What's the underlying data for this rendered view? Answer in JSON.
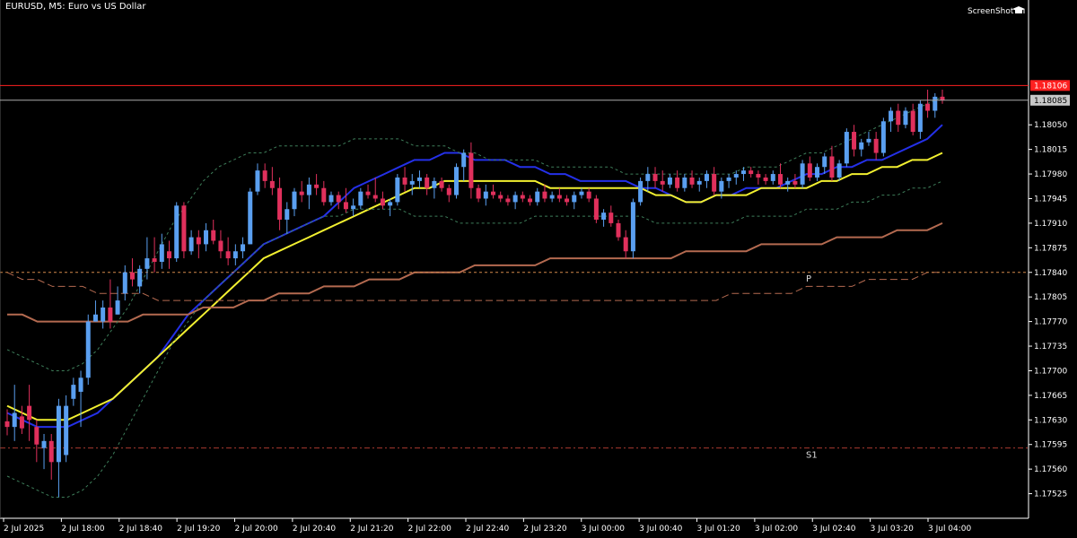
{
  "window": {
    "title": "EURUSD, M5:  Euro vs US Dollar"
  },
  "brand": {
    "label": "ScreenShot",
    "icon": "graduation-cap-icon"
  },
  "colors": {
    "background": "#000000",
    "axis": "#ffffff",
    "bull": "#5a9ff0",
    "bear": "#e0305c",
    "ma_fast": "#2430e8",
    "ma_mid": "#f2f030",
    "ma_slow": "#b46a50",
    "bollinger": "#3e7e5a",
    "pivot": "#d2884a",
    "s1": "#a83a30",
    "ask_line": "#ff2020",
    "bid_line": "#aaaaaa"
  },
  "chart_data": {
    "type": "candlestick",
    "symbol": "EURUSD",
    "timeframe": "M5",
    "description": "Euro vs US Dollar",
    "ylim": [
      1.1749,
      1.1822
    ],
    "price_ticks": [
      "1.18050",
      "1.18015",
      "1.17980",
      "1.17945",
      "1.17910",
      "1.17875",
      "1.17840",
      "1.17805",
      "1.17770",
      "1.17735",
      "1.17700",
      "1.17665",
      "1.17630",
      "1.17595",
      "1.17560",
      "1.17525"
    ],
    "time_ticks": [
      "2 Jul 2025",
      "2 Jul 18:00",
      "2 Jul 18:40",
      "2 Jul 19:20",
      "2 Jul 20:00",
      "2 Jul 20:40",
      "2 Jul 21:20",
      "2 Jul 22:00",
      "2 Jul 22:40",
      "2 Jul 23:20",
      "3 Jul 00:00",
      "3 Jul 00:40",
      "3 Jul 01:20",
      "3 Jul 02:00",
      "3 Jul 02:40",
      "3 Jul 03:20",
      "3 Jul 04:00"
    ],
    "ask_price": "1.18106",
    "bid_price": "1.18085",
    "levels": [
      {
        "name": "P",
        "price": 1.1784
      },
      {
        "name": "S1",
        "price": 1.1759
      }
    ],
    "candles": [
      [
        1.17628,
        1.17645,
        1.17608,
        1.1762
      ],
      [
        1.1762,
        1.1768,
        1.176,
        1.1764
      ],
      [
        1.17635,
        1.1765,
        1.1761,
        1.17618
      ],
      [
        1.1765,
        1.1768,
        1.176,
        1.1763
      ],
      [
        1.1762,
        1.1763,
        1.1757,
        1.17595
      ],
      [
        1.1759,
        1.1761,
        1.1756,
        1.176
      ],
      [
        1.176,
        1.1761,
        1.17545,
        1.1757
      ],
      [
        1.1757,
        1.1766,
        1.1752,
        1.1765
      ],
      [
        1.1758,
        1.17665,
        1.1757,
        1.1765
      ],
      [
        1.1766,
        1.1769,
        1.1765,
        1.1768
      ],
      [
        1.1767,
        1.177,
        1.1762,
        1.1769
      ],
      [
        1.1769,
        1.1778,
        1.1768,
        1.1777
      ],
      [
        1.1777,
        1.178,
        1.1777,
        1.1778
      ],
      [
        1.1777,
        1.178,
        1.1776,
        1.1779
      ],
      [
        1.1779,
        1.1783,
        1.1776,
        1.1777
      ],
      [
        1.1778,
        1.1782,
        1.1778,
        1.178
      ],
      [
        1.1781,
        1.1785,
        1.178,
        1.1784
      ],
      [
        1.1784,
        1.1786,
        1.1782,
        1.1783
      ],
      [
        1.1782,
        1.1785,
        1.1781,
        1.17845
      ],
      [
        1.17845,
        1.1789,
        1.1783,
        1.1786
      ],
      [
        1.1786,
        1.1789,
        1.1784,
        1.17855
      ],
      [
        1.17855,
        1.17895,
        1.17845,
        1.1788
      ],
      [
        1.1787,
        1.17885,
        1.17845,
        1.1786
      ],
      [
        1.1786,
        1.1794,
        1.17855,
        1.17935
      ],
      [
        1.17935,
        1.1794,
        1.1786,
        1.1787
      ],
      [
        1.1787,
        1.179,
        1.17865,
        1.1789
      ],
      [
        1.1789,
        1.179,
        1.1786,
        1.1788
      ],
      [
        1.1788,
        1.1791,
        1.1787,
        1.179
      ],
      [
        1.179,
        1.17915,
        1.1788,
        1.17885
      ],
      [
        1.17885,
        1.179,
        1.1786,
        1.1787
      ],
      [
        1.1787,
        1.1789,
        1.1785,
        1.1786
      ],
      [
        1.1786,
        1.1788,
        1.1785,
        1.1787
      ],
      [
        1.1787,
        1.1789,
        1.1786,
        1.1788
      ],
      [
        1.1788,
        1.1796,
        1.1788,
        1.17955
      ],
      [
        1.17955,
        1.17995,
        1.1795,
        1.17985
      ],
      [
        1.17985,
        1.17995,
        1.1796,
        1.1797
      ],
      [
        1.1797,
        1.1799,
        1.1795,
        1.1796
      ],
      [
        1.1796,
        1.17975,
        1.179,
        1.17915
      ],
      [
        1.17915,
        1.1794,
        1.17895,
        1.1793
      ],
      [
        1.1793,
        1.1796,
        1.1792,
        1.17955
      ],
      [
        1.17955,
        1.1797,
        1.1794,
        1.1795
      ],
      [
        1.1795,
        1.17975,
        1.1793,
        1.17965
      ],
      [
        1.17965,
        1.1798,
        1.1795,
        1.1796
      ],
      [
        1.1796,
        1.1797,
        1.17935,
        1.1794
      ],
      [
        1.1794,
        1.17955,
        1.17935,
        1.1795
      ],
      [
        1.1795,
        1.17955,
        1.1793,
        1.1794
      ],
      [
        1.1794,
        1.1796,
        1.17925,
        1.1793
      ],
      [
        1.1793,
        1.17945,
        1.1792,
        1.17935
      ],
      [
        1.17935,
        1.1796,
        1.1793,
        1.17955
      ],
      [
        1.17955,
        1.17965,
        1.17945,
        1.1795
      ],
      [
        1.1795,
        1.17975,
        1.1794,
        1.17945
      ],
      [
        1.17945,
        1.17955,
        1.1793,
        1.17935
      ],
      [
        1.17935,
        1.17945,
        1.1792,
        1.1794
      ],
      [
        1.1794,
        1.1798,
        1.17935,
        1.17975
      ],
      [
        1.17975,
        1.1799,
        1.17955,
        1.17965
      ],
      [
        1.17965,
        1.1798,
        1.1795,
        1.1797
      ],
      [
        1.1797,
        1.17985,
        1.1796,
        1.17975
      ],
      [
        1.17975,
        1.1798,
        1.1795,
        1.1796
      ],
      [
        1.1796,
        1.17975,
        1.17945,
        1.1797
      ],
      [
        1.1797,
        1.17975,
        1.17955,
        1.1796
      ],
      [
        1.1796,
        1.17965,
        1.1794,
        1.1795
      ],
      [
        1.1795,
        1.17995,
        1.17945,
        1.1799
      ],
      [
        1.1799,
        1.18015,
        1.1797,
        1.1801
      ],
      [
        1.1801,
        1.18025,
        1.17945,
        1.1796
      ],
      [
        1.1796,
        1.17965,
        1.1794,
        1.17945
      ],
      [
        1.17945,
        1.17965,
        1.17935,
        1.17955
      ],
      [
        1.17955,
        1.17965,
        1.17945,
        1.1795
      ],
      [
        1.1795,
        1.17955,
        1.1794,
        1.17945
      ],
      [
        1.17945,
        1.1795,
        1.17935,
        1.1794
      ],
      [
        1.1794,
        1.17955,
        1.1793,
        1.1795
      ],
      [
        1.1795,
        1.17955,
        1.1794,
        1.17945
      ],
      [
        1.17945,
        1.1795,
        1.17935,
        1.1794
      ],
      [
        1.1794,
        1.1796,
        1.17935,
        1.17955
      ],
      [
        1.17955,
        1.17965,
        1.1794,
        1.17945
      ],
      [
        1.17945,
        1.17955,
        1.1794,
        1.1795
      ],
      [
        1.1795,
        1.1796,
        1.1794,
        1.17945
      ],
      [
        1.17945,
        1.1795,
        1.17935,
        1.1794
      ],
      [
        1.1794,
        1.17955,
        1.1793,
        1.1795
      ],
      [
        1.1795,
        1.1796,
        1.17945,
        1.17955
      ],
      [
        1.17955,
        1.1796,
        1.1794,
        1.17945
      ],
      [
        1.17945,
        1.1795,
        1.1791,
        1.17915
      ],
      [
        1.17915,
        1.1793,
        1.17905,
        1.17925
      ],
      [
        1.17925,
        1.17935,
        1.17905,
        1.1791
      ],
      [
        1.1791,
        1.17915,
        1.17885,
        1.1789
      ],
      [
        1.1789,
        1.179,
        1.1786,
        1.1787
      ],
      [
        1.1787,
        1.17945,
        1.1786,
        1.1794
      ],
      [
        1.1794,
        1.17975,
        1.17935,
        1.1797
      ],
      [
        1.1797,
        1.1799,
        1.17955,
        1.1798
      ],
      [
        1.1798,
        1.1799,
        1.1796,
        1.1797
      ],
      [
        1.1797,
        1.17985,
        1.17955,
        1.17965
      ],
      [
        1.17965,
        1.1798,
        1.1796,
        1.17975
      ],
      [
        1.17975,
        1.17985,
        1.17955,
        1.1796
      ],
      [
        1.1796,
        1.1798,
        1.17955,
        1.17975
      ],
      [
        1.17975,
        1.17985,
        1.1796,
        1.17965
      ],
      [
        1.17965,
        1.17975,
        1.17955,
        1.1797
      ],
      [
        1.1797,
        1.17985,
        1.1796,
        1.1798
      ],
      [
        1.1798,
        1.1799,
        1.1795,
        1.17955
      ],
      [
        1.17955,
        1.17975,
        1.17945,
        1.1797
      ],
      [
        1.1797,
        1.1798,
        1.1796,
        1.17975
      ],
      [
        1.17975,
        1.17985,
        1.17965,
        1.1798
      ],
      [
        1.1798,
        1.1799,
        1.1797,
        1.17985
      ],
      [
        1.17985,
        1.1799,
        1.17975,
        1.1798
      ],
      [
        1.1798,
        1.17985,
        1.17965,
        1.17975
      ],
      [
        1.17975,
        1.1798,
        1.17965,
        1.1797
      ],
      [
        1.1797,
        1.17985,
        1.17965,
        1.1798
      ],
      [
        1.1798,
        1.17995,
        1.1796,
        1.17965
      ],
      [
        1.17965,
        1.17975,
        1.17955,
        1.1797
      ],
      [
        1.1797,
        1.1798,
        1.1796,
        1.17965
      ],
      [
        1.17965,
        1.18,
        1.1796,
        1.17995
      ],
      [
        1.17995,
        1.18005,
        1.1797,
        1.17975
      ],
      [
        1.17975,
        1.17995,
        1.1797,
        1.1799
      ],
      [
        1.1799,
        1.1801,
        1.1798,
        1.18005
      ],
      [
        1.18005,
        1.1802,
        1.1797,
        1.17975
      ],
      [
        1.17975,
        1.18,
        1.1797,
        1.17995
      ],
      [
        1.17995,
        1.18045,
        1.1799,
        1.1804
      ],
      [
        1.1804,
        1.1805,
        1.18005,
        1.18015
      ],
      [
        1.18015,
        1.1803,
        1.18005,
        1.18025
      ],
      [
        1.18025,
        1.1804,
        1.1802,
        1.1803
      ],
      [
        1.1803,
        1.1804,
        1.18,
        1.1801
      ],
      [
        1.1801,
        1.1806,
        1.18005,
        1.18055
      ],
      [
        1.18055,
        1.18075,
        1.1804,
        1.1807
      ],
      [
        1.1807,
        1.1808,
        1.1804,
        1.1805
      ],
      [
        1.1805,
        1.18075,
        1.18045,
        1.1807
      ],
      [
        1.1807,
        1.1808,
        1.18035,
        1.1804
      ],
      [
        1.1804,
        1.18085,
        1.1803,
        1.1808
      ],
      [
        1.1808,
        1.181,
        1.1806,
        1.1807
      ],
      [
        1.1807,
        1.18095,
        1.1806,
        1.1809
      ],
      [
        1.1809,
        1.181,
        1.1808,
        1.18085
      ]
    ],
    "series": [
      {
        "name": "MA fast",
        "style": "solid",
        "values": [
          1.1764,
          1.1763,
          1.1762,
          1.1762,
          1.1762,
          1.1763,
          1.1764,
          1.1766,
          1.1768,
          1.177,
          1.1772,
          1.1775,
          1.1778,
          1.178,
          1.1782,
          1.1784,
          1.1786,
          1.1788,
          1.1789,
          1.179,
          1.1791,
          1.1792,
          1.1794,
          1.1796,
          1.1797,
          1.1798,
          1.1799,
          1.18,
          1.18,
          1.1801,
          1.1801,
          1.18,
          1.18,
          1.18,
          1.1799,
          1.1799,
          1.1798,
          1.1798,
          1.1797,
          1.1797,
          1.1797,
          1.1797,
          1.1796,
          1.1796,
          1.1795,
          1.1794,
          1.1794,
          1.1795,
          1.1795,
          1.1796,
          1.1796,
          1.1796,
          1.1797,
          1.1798,
          1.1798,
          1.1799,
          1.1799,
          1.18,
          1.18,
          1.1801,
          1.1802,
          1.1803,
          1.1805
        ]
      },
      {
        "name": "MA mid",
        "style": "solid",
        "values": [
          1.1765,
          1.1764,
          1.1763,
          1.1763,
          1.1763,
          1.1764,
          1.1765,
          1.1766,
          1.1768,
          1.177,
          1.1772,
          1.1774,
          1.1776,
          1.1778,
          1.178,
          1.1782,
          1.1784,
          1.1786,
          1.1787,
          1.1788,
          1.1789,
          1.179,
          1.1791,
          1.1792,
          1.1793,
          1.1794,
          1.1795,
          1.1796,
          1.1796,
          1.1797,
          1.1797,
          1.1797,
          1.1797,
          1.1797,
          1.1797,
          1.1797,
          1.1796,
          1.1796,
          1.1796,
          1.1796,
          1.1796,
          1.1796,
          1.1796,
          1.1795,
          1.1795,
          1.1794,
          1.1794,
          1.1795,
          1.1795,
          1.1795,
          1.1796,
          1.1796,
          1.1796,
          1.1796,
          1.1797,
          1.1797,
          1.1798,
          1.1798,
          1.1799,
          1.1799,
          1.18,
          1.18,
          1.1801
        ]
      },
      {
        "name": "MA slow",
        "style": "solid",
        "values": [
          1.1778,
          1.1778,
          1.1777,
          1.1777,
          1.1777,
          1.1777,
          1.1777,
          1.1777,
          1.1777,
          1.1778,
          1.1778,
          1.1778,
          1.1778,
          1.1779,
          1.1779,
          1.1779,
          1.178,
          1.178,
          1.1781,
          1.1781,
          1.1781,
          1.1782,
          1.1782,
          1.1782,
          1.1783,
          1.1783,
          1.1783,
          1.1784,
          1.1784,
          1.1784,
          1.1784,
          1.1785,
          1.1785,
          1.1785,
          1.1785,
          1.1785,
          1.1786,
          1.1786,
          1.1786,
          1.1786,
          1.1786,
          1.1786,
          1.1786,
          1.1786,
          1.1786,
          1.1787,
          1.1787,
          1.1787,
          1.1787,
          1.1787,
          1.1788,
          1.1788,
          1.1788,
          1.1788,
          1.1788,
          1.1789,
          1.1789,
          1.1789,
          1.1789,
          1.179,
          1.179,
          1.179,
          1.1791
        ]
      },
      {
        "name": "MA slow lagged",
        "style": "dashed",
        "values": [
          1.1784,
          1.1783,
          1.1783,
          1.1782,
          1.1782,
          1.1782,
          1.1781,
          1.1781,
          1.1781,
          1.1781,
          1.178,
          1.178,
          1.178,
          1.178,
          1.178,
          1.178,
          1.178,
          1.178,
          1.178,
          1.178,
          1.178,
          1.178,
          1.178,
          1.178,
          1.178,
          1.178,
          1.178,
          1.178,
          1.178,
          1.178,
          1.178,
          1.178,
          1.178,
          1.178,
          1.178,
          1.178,
          1.178,
          1.178,
          1.178,
          1.178,
          1.178,
          1.178,
          1.178,
          1.178,
          1.178,
          1.178,
          1.178,
          1.178,
          1.1781,
          1.1781,
          1.1781,
          1.1781,
          1.1781,
          1.1782,
          1.1782,
          1.1782,
          1.1782,
          1.1783,
          1.1783,
          1.1783,
          1.1783,
          1.1784,
          1.1784
        ]
      },
      {
        "name": "Bollinger upper",
        "style": "dotted",
        "values": [
          1.1773,
          1.1772,
          1.1771,
          1.177,
          1.177,
          1.1771,
          1.1773,
          1.1776,
          1.1779,
          1.1783,
          1.1787,
          1.1791,
          1.1794,
          1.1797,
          1.1799,
          1.18,
          1.1801,
          1.1801,
          1.1802,
          1.1802,
          1.1802,
          1.1802,
          1.1802,
          1.1803,
          1.1803,
          1.1803,
          1.1803,
          1.1802,
          1.1802,
          1.1802,
          1.1801,
          1.1801,
          1.18,
          1.18,
          1.18,
          1.18,
          1.1799,
          1.1799,
          1.1799,
          1.1799,
          1.1799,
          1.1798,
          1.1798,
          1.1798,
          1.1798,
          1.1798,
          1.1798,
          1.1798,
          1.1798,
          1.1799,
          1.1799,
          1.1799,
          1.18,
          1.1801,
          1.1801,
          1.1802,
          1.1803,
          1.1804,
          1.1805,
          1.1806,
          1.1807,
          1.1808,
          1.1809
        ]
      },
      {
        "name": "Bollinger lower",
        "style": "dotted",
        "values": [
          1.1755,
          1.1754,
          1.1753,
          1.1752,
          1.1752,
          1.1753,
          1.1755,
          1.1758,
          1.1762,
          1.1766,
          1.177,
          1.1774,
          1.1777,
          1.178,
          1.1782,
          1.1784,
          1.1786,
          1.1788,
          1.1789,
          1.179,
          1.1791,
          1.1792,
          1.1792,
          1.1793,
          1.1793,
          1.1793,
          1.1793,
          1.1792,
          1.1792,
          1.1792,
          1.1791,
          1.1791,
          1.1791,
          1.1791,
          1.1791,
          1.1792,
          1.1792,
          1.1792,
          1.1792,
          1.1792,
          1.1792,
          1.1792,
          1.1792,
          1.1791,
          1.1791,
          1.1791,
          1.1791,
          1.1791,
          1.1791,
          1.1792,
          1.1792,
          1.1792,
          1.1792,
          1.1793,
          1.1793,
          1.1793,
          1.1794,
          1.1794,
          1.1795,
          1.1795,
          1.1796,
          1.1796,
          1.1797
        ]
      }
    ]
  }
}
